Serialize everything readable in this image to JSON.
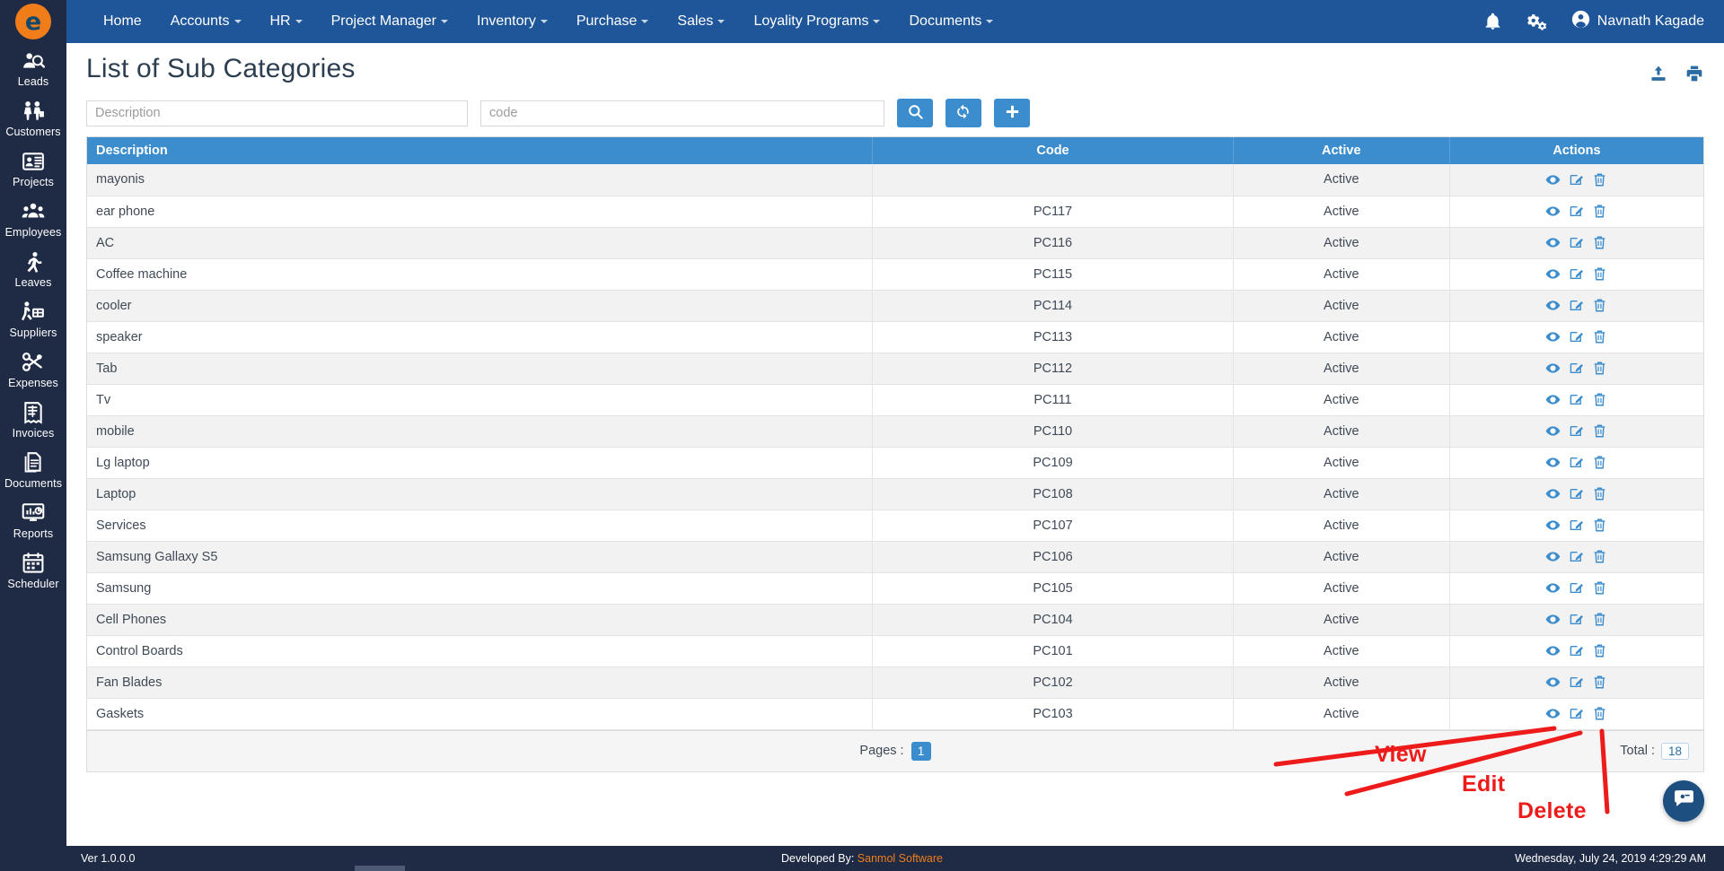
{
  "brand": {
    "logo_letter": "e",
    "logo_color": "#f07d1a"
  },
  "theme": {
    "primary": "#1f5699",
    "accent": "#3c8dcd",
    "sidebar": "#1f2a44",
    "annotation": "#ee1b1b"
  },
  "sidebar": {
    "items": [
      {
        "label": "Leads",
        "icon": "leads-icon"
      },
      {
        "label": "Customers",
        "icon": "customers-icon"
      },
      {
        "label": "Projects",
        "icon": "projects-icon"
      },
      {
        "label": "Employees",
        "icon": "employees-icon"
      },
      {
        "label": "Leaves",
        "icon": "leaves-icon"
      },
      {
        "label": "Suppliers",
        "icon": "suppliers-icon"
      },
      {
        "label": "Expenses",
        "icon": "expenses-icon"
      },
      {
        "label": "Invoices",
        "icon": "invoices-icon"
      },
      {
        "label": "Documents",
        "icon": "documents-icon"
      },
      {
        "label": "Reports",
        "icon": "reports-icon"
      },
      {
        "label": "Scheduler",
        "icon": "scheduler-icon"
      }
    ]
  },
  "topnav": {
    "items": [
      {
        "label": "Home",
        "has_caret": false
      },
      {
        "label": "Accounts",
        "has_caret": true
      },
      {
        "label": "HR",
        "has_caret": true
      },
      {
        "label": "Project Manager",
        "has_caret": true
      },
      {
        "label": "Inventory",
        "has_caret": true
      },
      {
        "label": "Purchase",
        "has_caret": true
      },
      {
        "label": "Sales",
        "has_caret": true
      },
      {
        "label": "Loyality Programs",
        "has_caret": true
      },
      {
        "label": "Documents",
        "has_caret": true
      }
    ],
    "notification_icon": "bell-icon",
    "settings_icon": "gears-icon",
    "user_icon": "user-avatar-icon",
    "user_name": "Navnath Kagade"
  },
  "page": {
    "title": "List of Sub Categories",
    "upload_icon": "upload-icon",
    "print_icon": "print-icon"
  },
  "filters": {
    "description_placeholder": "Description",
    "description_value": "",
    "code_placeholder": "code",
    "code_value": "",
    "search_button": "search-icon",
    "refresh_button": "refresh-icon",
    "add_button": "plus-icon"
  },
  "table": {
    "columns": [
      "Description",
      "Code",
      "Active",
      "Actions"
    ],
    "rows": [
      {
        "description": "mayonis",
        "code": "",
        "active": "Active"
      },
      {
        "description": "ear phone",
        "code": "PC117",
        "active": "Active"
      },
      {
        "description": "AC",
        "code": "PC116",
        "active": "Active"
      },
      {
        "description": "Coffee machine",
        "code": "PC115",
        "active": "Active"
      },
      {
        "description": "cooler",
        "code": "PC114",
        "active": "Active"
      },
      {
        "description": "speaker",
        "code": "PC113",
        "active": "Active"
      },
      {
        "description": "Tab",
        "code": "PC112",
        "active": "Active"
      },
      {
        "description": "Tv",
        "code": "PC111",
        "active": "Active"
      },
      {
        "description": "mobile",
        "code": "PC110",
        "active": "Active"
      },
      {
        "description": "Lg laptop",
        "code": "PC109",
        "active": "Active"
      },
      {
        "description": "Laptop",
        "code": "PC108",
        "active": "Active"
      },
      {
        "description": "Services",
        "code": "PC107",
        "active": "Active"
      },
      {
        "description": "Samsung Gallaxy S5",
        "code": "PC106",
        "active": "Active"
      },
      {
        "description": "Samsung",
        "code": "PC105",
        "active": "Active"
      },
      {
        "description": "Cell Phones",
        "code": "PC104",
        "active": "Active"
      },
      {
        "description": "Control Boards",
        "code": "PC101",
        "active": "Active"
      },
      {
        "description": "Fan Blades",
        "code": "PC102",
        "active": "Active"
      },
      {
        "description": "Gaskets",
        "code": "PC103",
        "active": "Active"
      }
    ],
    "row_actions": [
      "view-icon",
      "edit-icon",
      "delete-icon"
    ],
    "pages_label": "Pages :",
    "current_page": "1",
    "total_label": "Total :",
    "total_value": "18"
  },
  "annotations": [
    {
      "text": "View"
    },
    {
      "text": "Edit"
    },
    {
      "text": "Delete"
    }
  ],
  "chat": {
    "icon": "chat-bubble-icon"
  },
  "footer": {
    "version": "Ver 1.0.0.0",
    "developed_by_label": "Developed By:",
    "developer": "Sanmol Software",
    "datetime": "Wednesday, July 24, 2019 4:29:29 AM"
  }
}
